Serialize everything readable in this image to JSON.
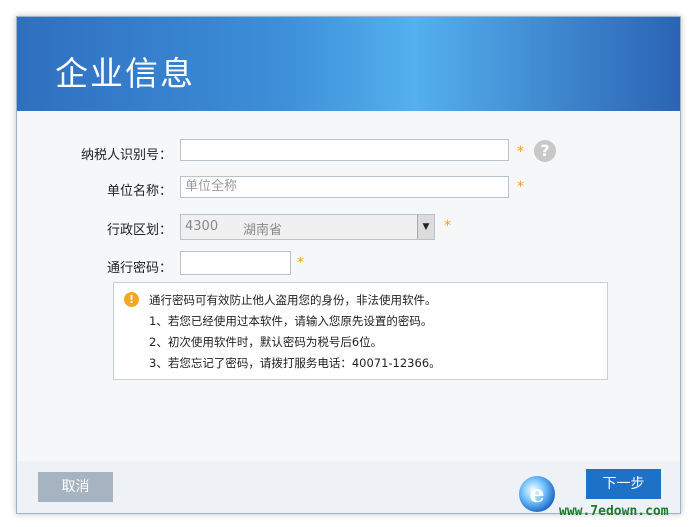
{
  "header": {
    "title": "企业信息"
  },
  "form": {
    "taxpayer_id": {
      "label": "纳税人识别号：",
      "value": "",
      "required": "*"
    },
    "unit_name": {
      "label": "单位名称：",
      "placeholder": "单位全称",
      "required": "*"
    },
    "region": {
      "label": "行政区划：",
      "code": "4300",
      "province": "湖南省",
      "required": "*"
    },
    "password": {
      "label": "通行密码：",
      "value": "",
      "required": "*"
    },
    "help_icon": "?"
  },
  "notice": {
    "icon": "!",
    "lines": [
      "通行密码可有效防止他人盗用您的身份，非法使用软件。",
      "1、若您已经使用过本软件，请输入您原先设置的密码。",
      "2、初次使用软件时，默认密码为税号后6位。",
      "3、若您忘记了密码，请拨打服务电话：40071-12366。"
    ]
  },
  "footer": {
    "cancel_label": "取消",
    "confirm_label": "下一步"
  },
  "watermark": {
    "url": "www.7edown.com"
  },
  "colors": {
    "header_start": "#2f6fc0",
    "header_end": "#2b64b4",
    "required_star": "#f0a020",
    "cancel_bg": "#a6b3c0",
    "confirm_bg": "#1d72c8",
    "notice_icon": "#f5a623"
  }
}
